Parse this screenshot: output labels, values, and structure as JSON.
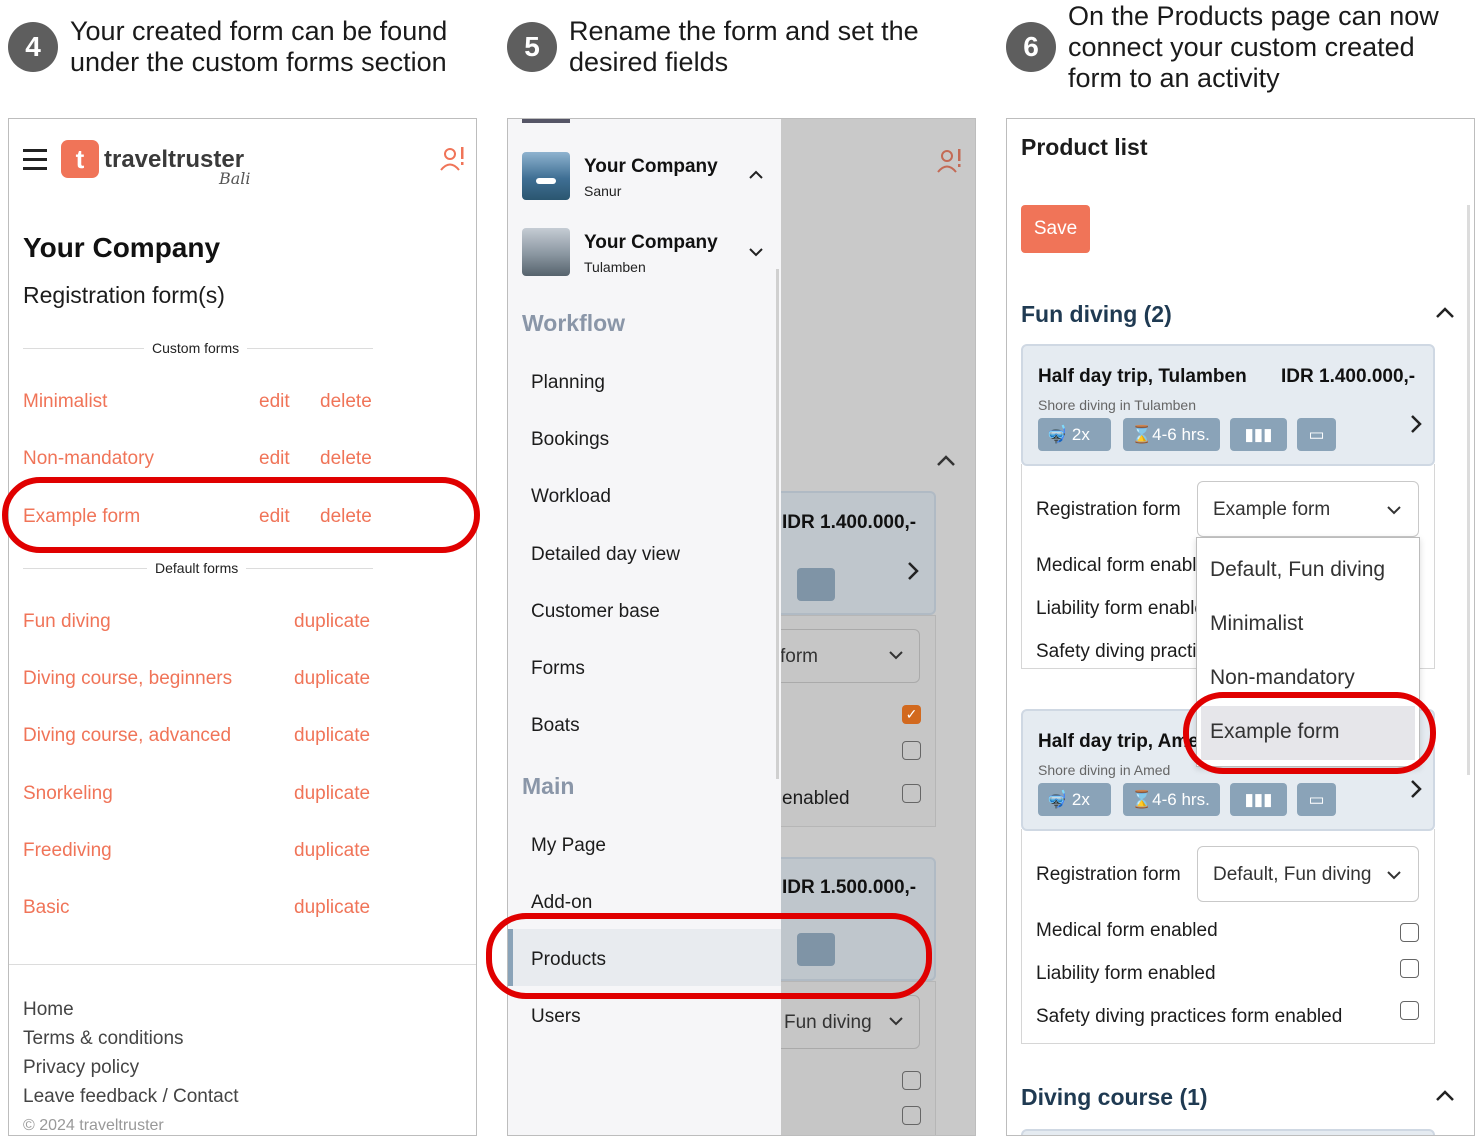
{
  "steps": [
    {
      "num": "4",
      "line1": "Your created form can be found",
      "line2": "under the custom forms section"
    },
    {
      "num": "5",
      "line1": "Rename the form and set the",
      "line2": "desired fields"
    },
    {
      "num": "6",
      "line1": "On the Products page can now",
      "line2": "connect your custom created",
      "line3": "form to an activity"
    }
  ],
  "p1": {
    "brand": "traveltruster",
    "brand_sub": "Bali",
    "company": "Your Company",
    "subtitle": "Registration form(s)",
    "custom_label": "Custom forms",
    "custom_forms": [
      {
        "name": "Minimalist",
        "edit": "edit",
        "delete": "delete"
      },
      {
        "name": "Non-mandatory",
        "edit": "edit",
        "delete": "delete"
      },
      {
        "name": "Example form",
        "edit": "edit",
        "delete": "delete"
      }
    ],
    "default_label": "Default forms",
    "default_forms": [
      {
        "name": "Fun diving",
        "action": "duplicate"
      },
      {
        "name": "Diving course, beginners",
        "action": "duplicate"
      },
      {
        "name": "Diving course, advanced",
        "action": "duplicate"
      },
      {
        "name": "Snorkeling",
        "action": "duplicate"
      },
      {
        "name": "Freediving",
        "action": "duplicate"
      },
      {
        "name": "Basic",
        "action": "duplicate"
      }
    ],
    "footer": [
      "Home",
      "Terms & conditions",
      "Privacy policy",
      "Leave feedback / Contact"
    ],
    "copyright": "© 2024 traveltruster"
  },
  "p2": {
    "companies": [
      {
        "name": "Your Company",
        "location": "Sanur"
      },
      {
        "name": "Your Company",
        "location": "Tulamben"
      }
    ],
    "sec_workflow": "Workflow",
    "workflow": [
      "Planning",
      "Bookings",
      "Workload",
      "Detailed day view",
      "Customer base",
      "Forms",
      "Boats"
    ],
    "sec_main": "Main",
    "main": [
      "My Page",
      "Add-on",
      "Products",
      "Users"
    ],
    "bg_price1": "IDR 1.400.000,-",
    "bg_price2": "IDR 1.500.000,-",
    "bg_form": "form",
    "bg_enabled": "enabled",
    "bg_fun": "Fun diving"
  },
  "p3": {
    "title": "Product list",
    "save": "Save",
    "group1": "Fun diving (2)",
    "group2": "Diving course (1)",
    "card1": {
      "title": "Half day trip, Tulamben",
      "price": "IDR 1.400.000,-",
      "sub": "Shore diving in Tulamben",
      "b_divers": "2x",
      "b_duration": "4-6 hrs."
    },
    "card2": {
      "title": "Half day trip, Amed",
      "sub": "Shore diving in Amed",
      "b_divers": "2x",
      "b_duration": "4-6 hrs."
    },
    "reg_label": "Registration form",
    "reg_value1": "Example form",
    "reg_value2": "Default, Fun diving",
    "medical": "Medical form enabled",
    "liability": "Liability form enabled",
    "safety": "Safety diving practices form enabled",
    "dropdown": [
      "Default, Fun diving",
      "Minimalist",
      "Non-mandatory",
      "Example form"
    ]
  },
  "colors": {
    "accent": "#f07458",
    "highlight": "#e00000",
    "badge": "#8aa3b8"
  }
}
